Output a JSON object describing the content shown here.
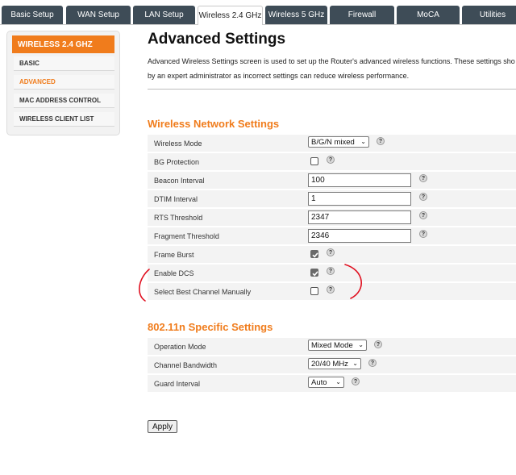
{
  "tabs": [
    {
      "label": "Basic Setup"
    },
    {
      "label": "WAN Setup"
    },
    {
      "label": "LAN Setup"
    },
    {
      "label": "Wireless 2.4 GHz"
    },
    {
      "label": "Wireless 5 GHz"
    },
    {
      "label": "Firewall"
    },
    {
      "label": "MoCA"
    },
    {
      "label": "Utilities"
    }
  ],
  "sidebar": {
    "title": "WIRELESS 2.4 GHZ",
    "items": [
      {
        "label": "BASIC"
      },
      {
        "label": "ADVANCED"
      },
      {
        "label": "MAC ADDRESS CONTROL"
      },
      {
        "label": "WIRELESS CLIENT LIST"
      }
    ]
  },
  "page": {
    "title": "Advanced Settings",
    "description_line1": "Advanced Wireless Settings screen is used to set up the Router's advanced wireless functions. These settings sho",
    "description_line2": "by an expert administrator as incorrect settings can reduce wireless performance."
  },
  "wireless_section": {
    "title": "Wireless Network Settings",
    "wireless_mode": {
      "label": "Wireless Mode",
      "value": "B/G/N mixed"
    },
    "bg_protection": {
      "label": "BG Protection",
      "checked": false
    },
    "beacon_interval": {
      "label": "Beacon Interval",
      "value": "100"
    },
    "dtim_interval": {
      "label": "DTIM Interval",
      "value": "1"
    },
    "rts_threshold": {
      "label": "RTS Threshold",
      "value": "2347"
    },
    "fragment_threshold": {
      "label": "Fragment Threshold",
      "value": "2346"
    },
    "frame_burst": {
      "label": "Frame Burst",
      "checked": true
    },
    "enable_dcs": {
      "label": "Enable DCS",
      "checked": true
    },
    "select_best_channel": {
      "label": "Select Best Channel Manually",
      "checked": false
    }
  },
  "n_section": {
    "title": "802.11n Specific Settings",
    "operation_mode": {
      "label": "Operation Mode",
      "value": "Mixed Mode"
    },
    "channel_bandwidth": {
      "label": "Channel Bandwidth",
      "value": "20/40 MHz"
    },
    "guard_interval": {
      "label": "Guard Interval",
      "value": "Auto"
    }
  },
  "help_glyph": "?",
  "apply_label": "Apply",
  "icons": {
    "help": "question-icon",
    "dropdown": "chevron-down-icon",
    "check": "checkmark-icon"
  },
  "colors": {
    "accent": "#f07c1c",
    "tab_bg": "#3e4c57",
    "row_bg": "#f3f3f3",
    "annotation": "#e01020"
  }
}
